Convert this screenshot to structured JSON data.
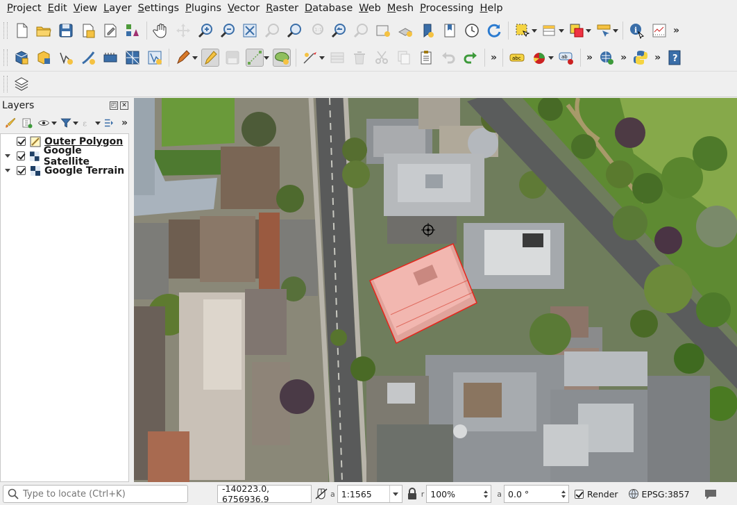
{
  "menu": [
    "Project",
    "Edit",
    "View",
    "Layer",
    "Settings",
    "Plugins",
    "Vector",
    "Raster",
    "Database",
    "Web",
    "Mesh",
    "Processing",
    "Help"
  ],
  "layers_panel": {
    "title": "Layers",
    "layers": [
      {
        "name": "Outer Polygon",
        "checked": true,
        "active": true,
        "icon": "polygon-layer-icon"
      },
      {
        "name": "Google Satellite",
        "checked": true,
        "active": false,
        "icon": "raster-layer-icon"
      },
      {
        "name": "Google Terrain",
        "checked": true,
        "active": false,
        "icon": "raster-layer-icon"
      }
    ]
  },
  "statusbar": {
    "locator_placeholder": "Type to locate (Ctrl+K)",
    "coordinate": "-140223.0, 6756936.9",
    "scale_label": "a",
    "scale": "1:1565",
    "magnifier_label": "r",
    "magnifier": "100%",
    "rotation_label": "a",
    "rotation": "0.0 °",
    "render_label": "Render",
    "crs": "EPSG:3857"
  },
  "colors": {
    "polygon_fill": "#f2b7b0",
    "polygon_stroke": "#e8241a",
    "toolbar_bg": "#efefef"
  }
}
